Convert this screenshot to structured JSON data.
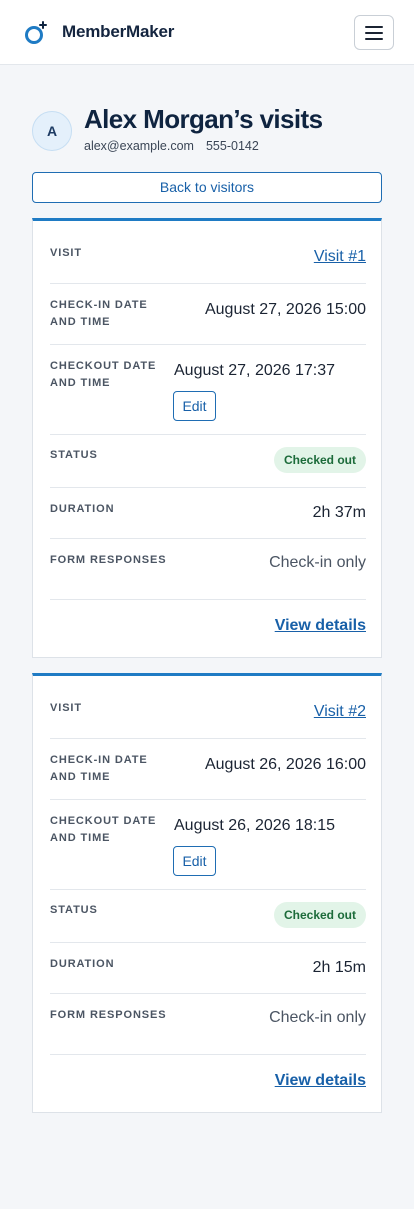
{
  "brand": {
    "name": "MemberMaker"
  },
  "colors": {
    "accent": "#1f7bc4",
    "link": "#1860a8",
    "badge_bg": "#e2f4e8",
    "badge_text": "#1c6b3a"
  },
  "header": {
    "avatar_initial": "A",
    "title": "Alex Morgan’s visits",
    "email": "alex@example.com",
    "phone": "555-0142",
    "back_label": "Back to visitors"
  },
  "labels": {
    "visit": "Visit",
    "checkin": "Check-in date and time",
    "checkout": "Checkout date and time",
    "status": "Status",
    "duration": "Duration",
    "form_responses": "Form responses"
  },
  "visits": [
    {
      "visit_link": "Visit #1",
      "checkin": "August 27, 2026 15:00",
      "checkout": "August 27, 2026 17:37",
      "edit_label": "Edit",
      "status": "Checked out",
      "duration": "2h 37m",
      "form_responses": "Check-in only",
      "details_link": "View details"
    },
    {
      "visit_link": "Visit #2",
      "checkin": "August 26, 2026 16:00",
      "checkout": "August 26, 2026 18:15",
      "edit_label": "Edit",
      "status": "Checked out",
      "duration": "2h 15m",
      "form_responses": "Check-in only",
      "details_link": "View details"
    }
  ]
}
